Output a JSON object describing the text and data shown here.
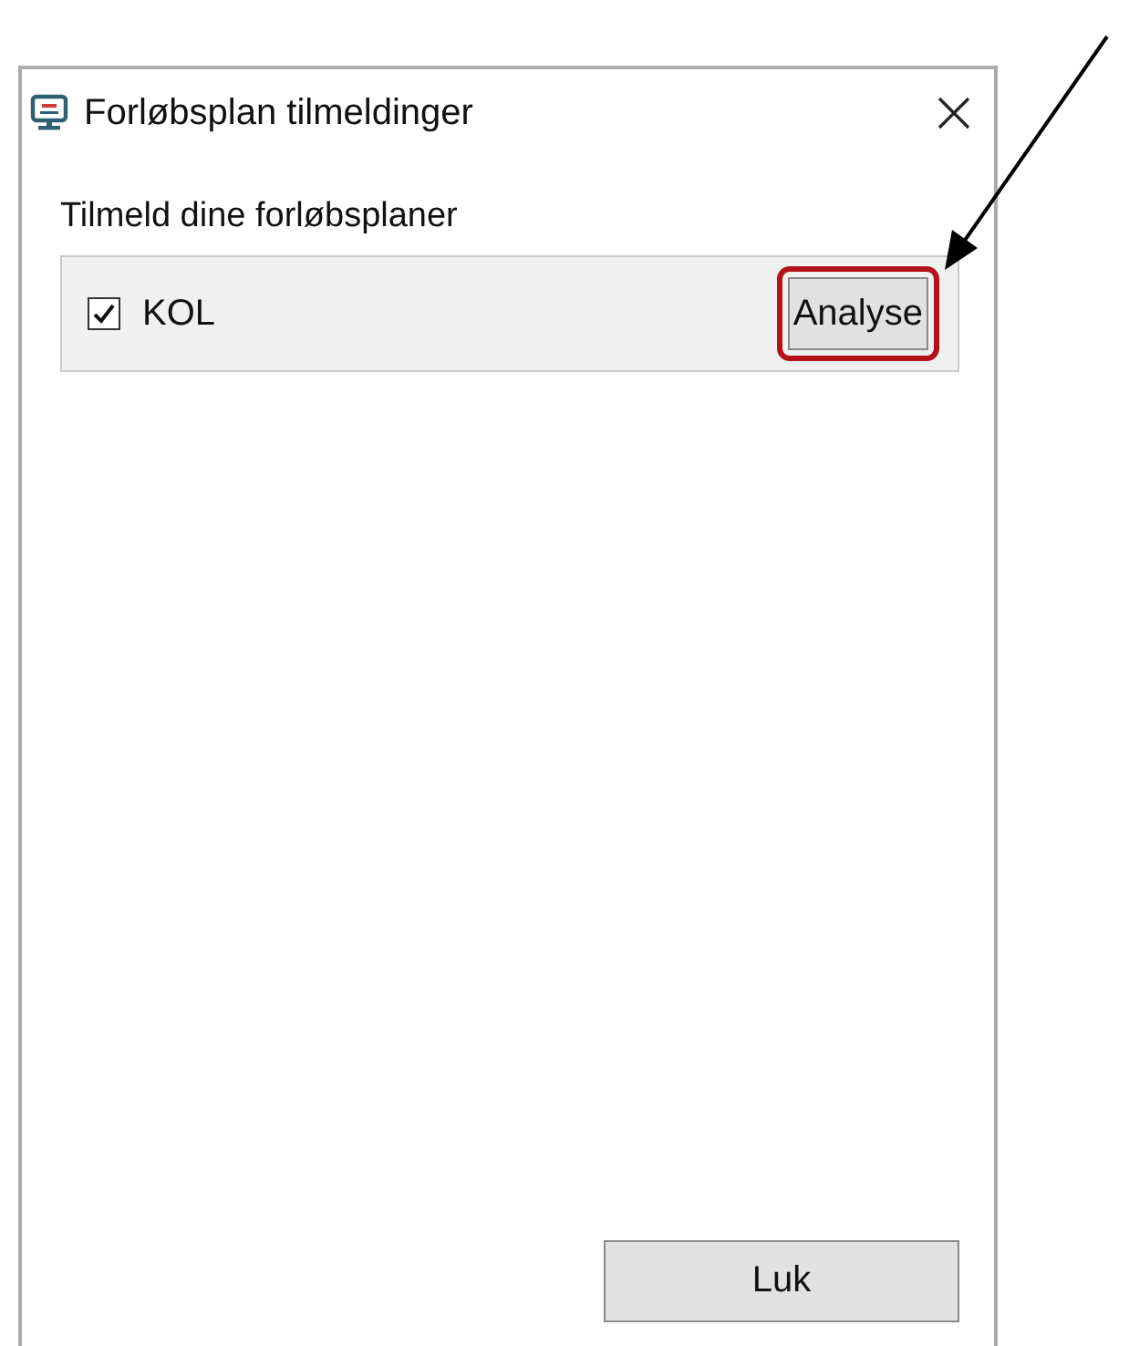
{
  "window": {
    "title": "Forløbsplan tilmeldinger"
  },
  "heading": "Tilmeld dine forløbsplaner",
  "plans": [
    {
      "name": "KOL",
      "checked": true,
      "button": "Analyse",
      "highlighted": true
    }
  ],
  "close_button": "Luk"
}
